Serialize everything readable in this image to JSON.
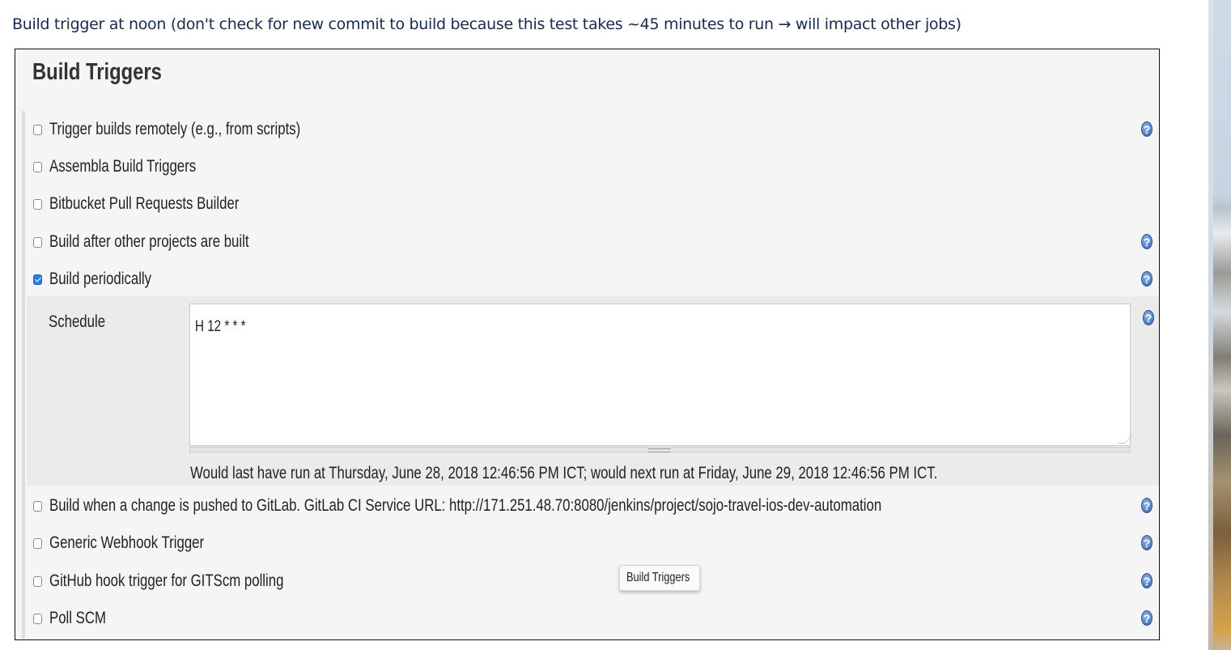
{
  "caption": "Build trigger at noon (don't check for new commit to build because this test takes ~45 minutes to run → will impact other jobs)",
  "panel": {
    "title": "Build Triggers",
    "help_icon": "?",
    "triggers": [
      {
        "label": "Trigger builds remotely (e.g., from scripts)",
        "checked": false,
        "help": true
      },
      {
        "label": "Assembla Build Triggers",
        "checked": false,
        "help": false
      },
      {
        "label": "Bitbucket Pull Requests Builder",
        "checked": false,
        "help": false
      },
      {
        "label": "Build after other projects are built",
        "checked": false,
        "help": true
      },
      {
        "label": "Build periodically",
        "checked": true,
        "help": true
      },
      {
        "label": "Build when a change is pushed to GitLab. GitLab CI Service URL: http://171.251.48.70:8080/jenkins/project/sojo-travel-ios-dev-automation",
        "checked": false,
        "help": true
      },
      {
        "label": "Generic Webhook Trigger",
        "checked": false,
        "help": true
      },
      {
        "label": "GitHub hook trigger for GITScm polling",
        "checked": false,
        "help": true
      },
      {
        "label": "Poll SCM",
        "checked": false,
        "help": true
      }
    ],
    "schedule": {
      "label": "Schedule",
      "value": "H 12 * * *",
      "note": "Would last have run at Thursday, June 28, 2018 12:46:56 PM ICT; would next run at Friday, June 29, 2018 12:46:56 PM ICT."
    },
    "tooltip": "Build Triggers"
  },
  "colors": {
    "checkbox_checked": "#2a7de1",
    "help_icon": "#3567b5",
    "panel_bg": "#f5f5f5",
    "caption_text": "#172b4d"
  }
}
